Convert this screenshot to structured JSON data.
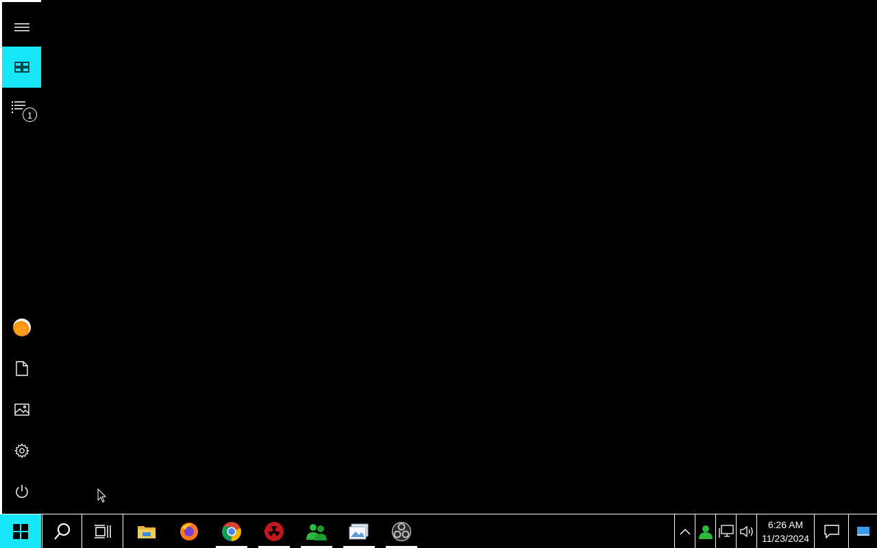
{
  "start_menu": {
    "rail_items": [
      {
        "name": "expand",
        "icon": "hamburger-menu-icon"
      },
      {
        "name": "pinned-tiles",
        "icon": "tiles-icon",
        "active": true
      },
      {
        "name": "all-apps",
        "icon": "list-icon",
        "badge": "1"
      },
      {
        "name": "account",
        "icon": "user-avatar-icon"
      },
      {
        "name": "documents",
        "icon": "document-icon"
      },
      {
        "name": "pictures",
        "icon": "pictures-icon"
      },
      {
        "name": "settings",
        "icon": "gear-icon"
      },
      {
        "name": "power",
        "icon": "power-icon"
      }
    ],
    "accent_color": "#18e7f8"
  },
  "taskbar": {
    "apps": [
      {
        "name": "file-explorer",
        "icon": "folder-icon",
        "running": false
      },
      {
        "name": "firefox",
        "icon": "firefox-icon",
        "running": false
      },
      {
        "name": "chrome",
        "icon": "chrome-icon",
        "running": true
      },
      {
        "name": "radiation-app",
        "icon": "radiation-icon",
        "running": true
      },
      {
        "name": "users-app",
        "icon": "users-icon",
        "running": true
      },
      {
        "name": "image-viewer",
        "icon": "image-viewer-icon",
        "running": true
      },
      {
        "name": "obs",
        "icon": "obs-icon",
        "running": true
      }
    ],
    "clock": {
      "time": "6:26 AM",
      "date": "11/23/2024"
    }
  }
}
